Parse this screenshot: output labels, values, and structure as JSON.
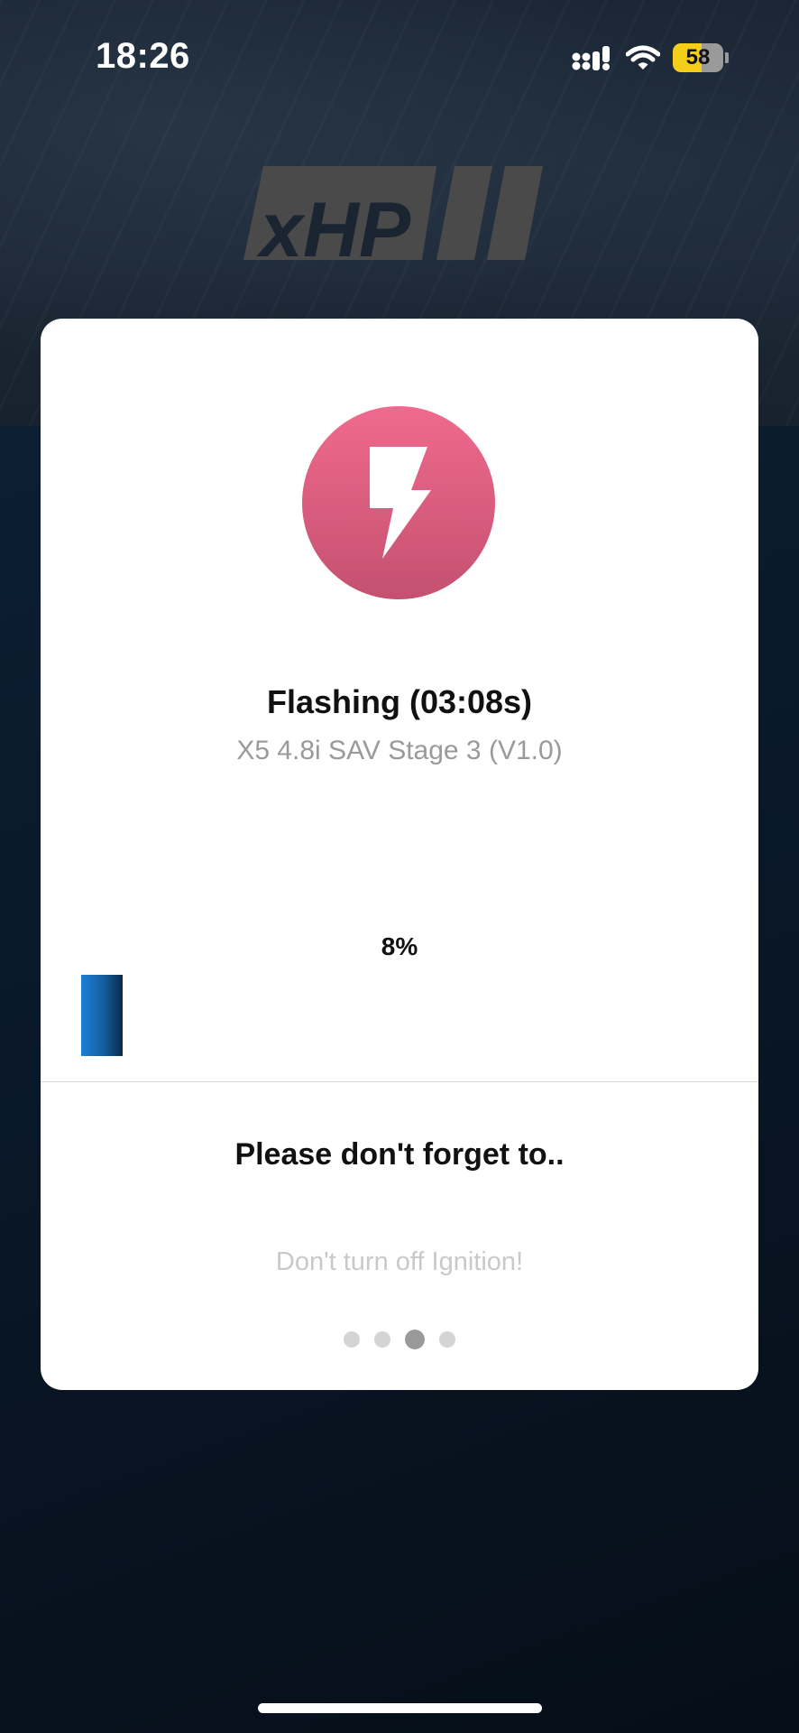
{
  "status_bar": {
    "time": "18:26",
    "battery_level": "58",
    "battery_fraction": 0.58,
    "icons": [
      "cellular-signal-icon",
      "wifi-icon",
      "battery-icon"
    ],
    "battery_color": "#f5cd1b"
  },
  "brand": {
    "logo_text": "xHP",
    "logo_color": "#4a4a4a"
  },
  "flash_dialog": {
    "icon": "lightning-bolt-icon",
    "icon_color": "#e5607f",
    "title": "Flashing (03:08s)",
    "subtitle": "X5 4.8i SAV Stage 3 (V1.0)",
    "progress_label": "8%",
    "progress_fraction": 0.065,
    "progress_color": "#1d7fd6",
    "reminder_title": "Please don't forget to..",
    "reminder_tip": "Don't turn off Ignition!",
    "pager": {
      "total": 4,
      "active_index": 2
    }
  }
}
